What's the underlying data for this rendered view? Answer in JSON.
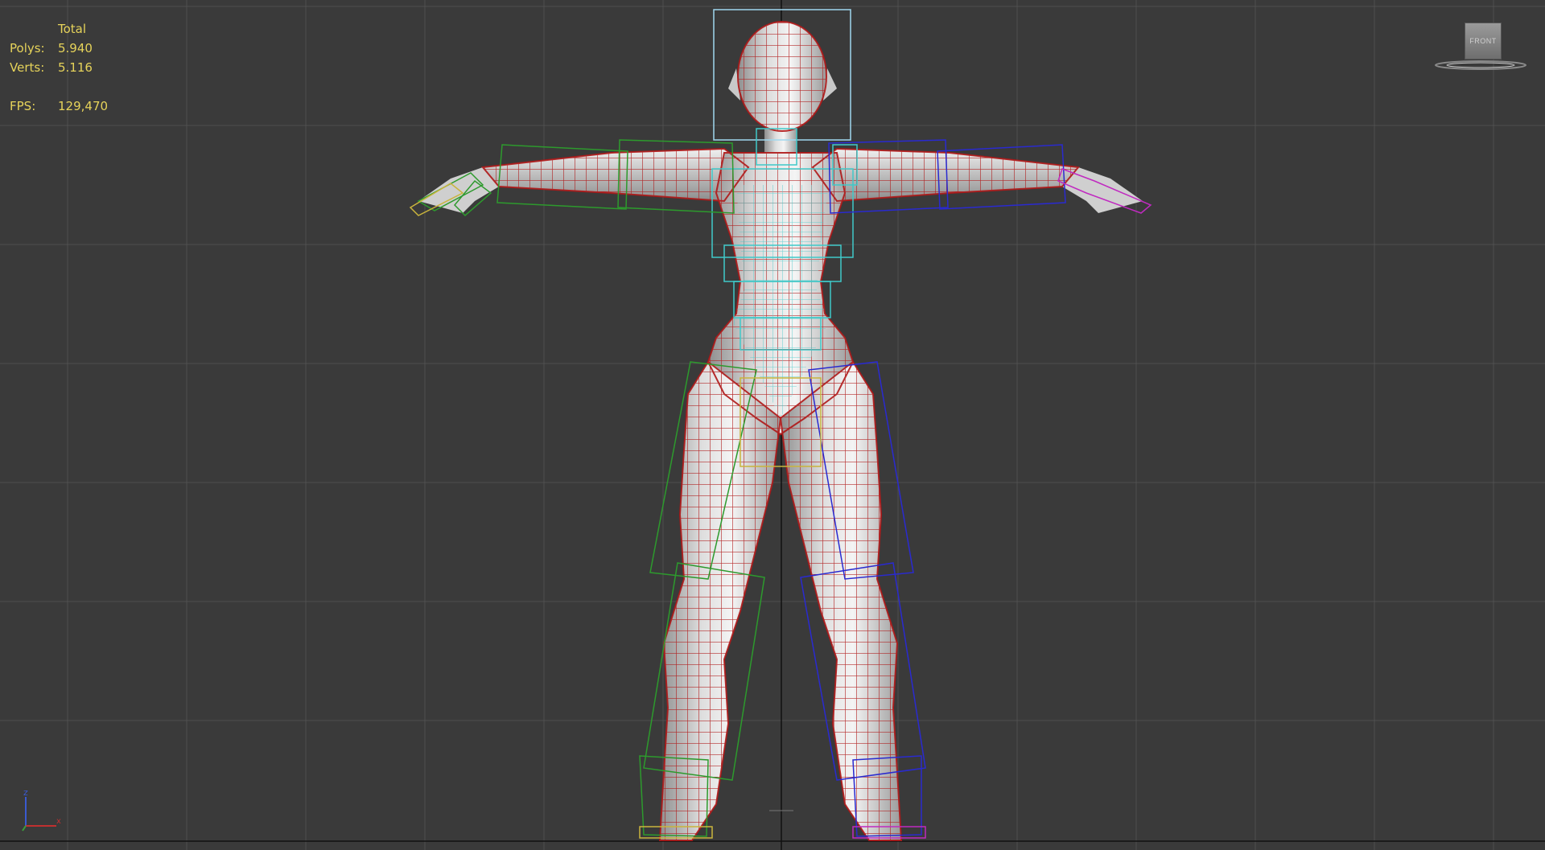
{
  "stats": {
    "header": "Total",
    "polys_label": "Polys:",
    "polys_value": "5.940",
    "verts_label": "Verts:",
    "verts_value": "5.116",
    "fps_label": "FPS:",
    "fps_value": "129,470"
  },
  "viewcube": {
    "face_label": "FRONT",
    "icon": "viewcube-icon"
  },
  "axis": {
    "z_label": "z",
    "x_label": "x",
    "icon": "axis-tripod-icon"
  },
  "colors": {
    "background": "#3a3a3a",
    "grid": "#4f4f4f",
    "stats_text": "#e6d35a",
    "wire_red": "#b01818",
    "bone_green": "#2d9a2d",
    "bone_blue": "#2a2ad0",
    "bone_cyan": "#3fc9c9",
    "bone_yellow": "#c9b43c",
    "bone_magenta": "#c02ac0"
  }
}
